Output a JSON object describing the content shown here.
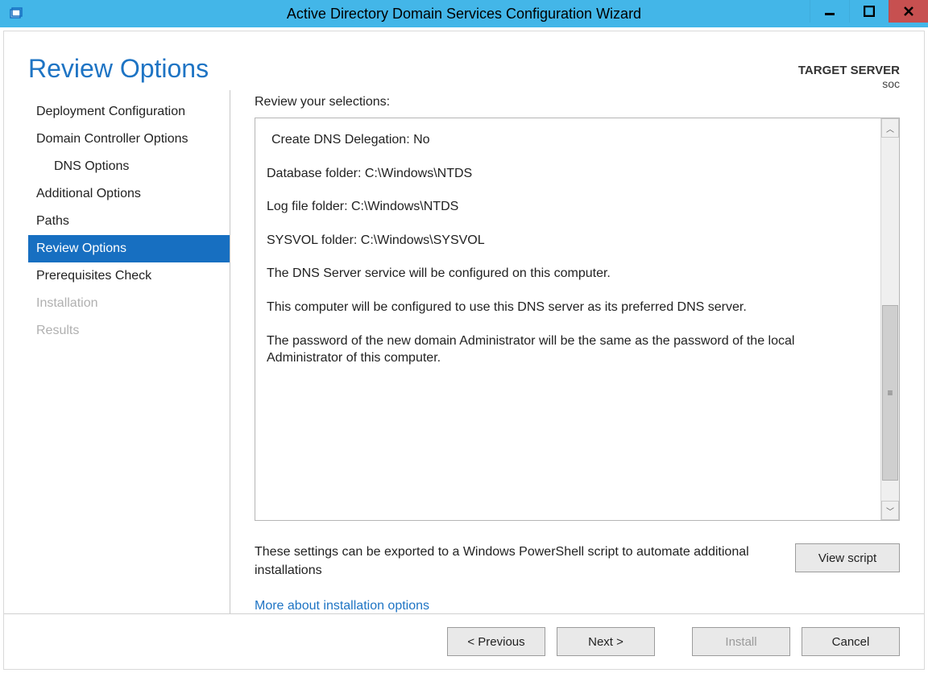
{
  "title": "Active Directory Domain Services Configuration Wizard",
  "header": {
    "page_title": "Review Options",
    "target_label": "TARGET SERVER",
    "target_server": "soc"
  },
  "sidebar": {
    "items": [
      {
        "label": "Deployment Configuration",
        "indent": false,
        "active": false,
        "disabled": false
      },
      {
        "label": "Domain Controller Options",
        "indent": false,
        "active": false,
        "disabled": false
      },
      {
        "label": "DNS Options",
        "indent": true,
        "active": false,
        "disabled": false
      },
      {
        "label": "Additional Options",
        "indent": false,
        "active": false,
        "disabled": false
      },
      {
        "label": "Paths",
        "indent": false,
        "active": false,
        "disabled": false
      },
      {
        "label": "Review Options",
        "indent": false,
        "active": true,
        "disabled": false
      },
      {
        "label": "Prerequisites Check",
        "indent": false,
        "active": false,
        "disabled": false
      },
      {
        "label": "Installation",
        "indent": false,
        "active": false,
        "disabled": true
      },
      {
        "label": "Results",
        "indent": false,
        "active": false,
        "disabled": true
      }
    ]
  },
  "main": {
    "review_label": "Review your selections:",
    "lines": [
      "Create DNS Delegation: No",
      "Database folder: C:\\Windows\\NTDS",
      "Log file folder: C:\\Windows\\NTDS",
      "SYSVOL folder: C:\\Windows\\SYSVOL",
      "The DNS Server service will be configured on this computer.",
      "This computer will be configured to use this DNS server as its preferred DNS server.",
      "The password of the new domain Administrator will be the same as the password of the local Administrator of this computer."
    ],
    "export_text": "These settings can be exported to a Windows PowerShell script to automate additional installations",
    "view_script": "View script",
    "more_link": "More about installation options"
  },
  "footer": {
    "previous": "< Previous",
    "next": "Next >",
    "install": "Install",
    "cancel": "Cancel"
  }
}
